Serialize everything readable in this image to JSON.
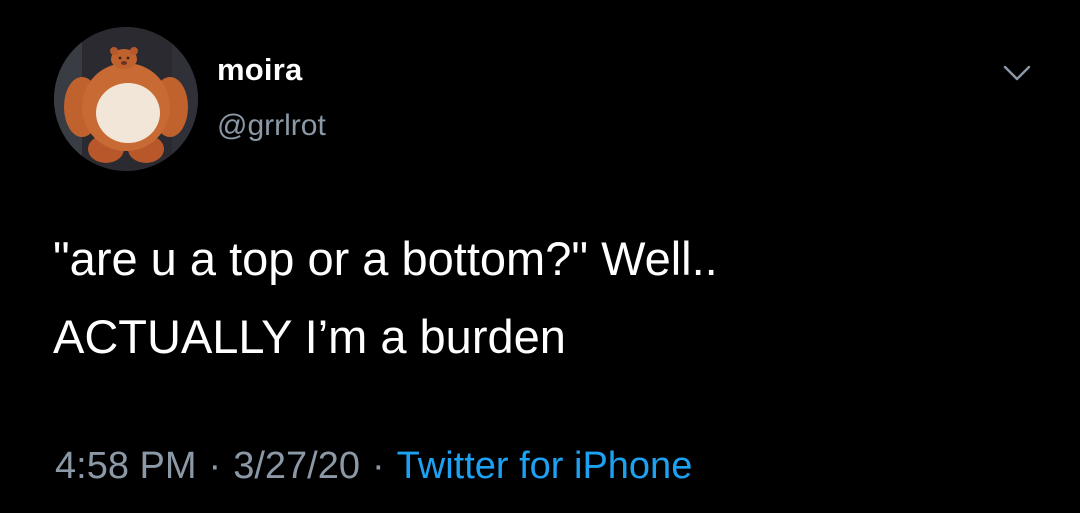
{
  "user": {
    "display_name": "moira",
    "handle": "@grrlrot"
  },
  "tweet": {
    "line1": "\"are u a top or a bottom?\" Well..",
    "line2": "ACTUALLY I’m a burden"
  },
  "meta": {
    "time": "4:58 PM",
    "separator": "·",
    "date": "3/27/20",
    "source": "Twitter for iPhone"
  },
  "icons": {
    "menu": "chevron-down-icon",
    "avatar": "plush-bear-avatar"
  },
  "colors": {
    "background": "#000000",
    "text": "#ffffff",
    "secondary": "#8b98a5",
    "link": "#1da1f2"
  }
}
